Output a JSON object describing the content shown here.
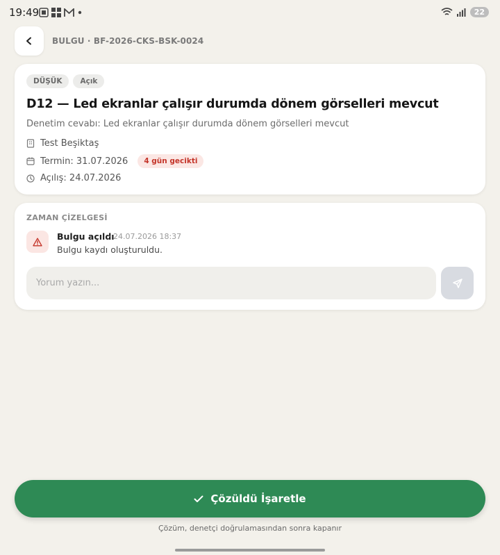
{
  "status_bar": {
    "time": "19:49",
    "battery": "22"
  },
  "header": {
    "breadcrumb": "BULGU · BF-2026-CKS-BSK-0024"
  },
  "finding": {
    "severity_badge": "DÜŞÜK",
    "status_badge": "Açık",
    "title": "D12 — Led ekranlar çalışır durumda dönem görselleri mevcut",
    "audit_answer": "Denetim cevabı: Led ekranlar çalışır durumda dönem görselleri mevcut",
    "location": "Test Beşiktaş",
    "due_date": "Termin: 31.07.2026",
    "late_badge": "4 gün gecikti",
    "opened_date": "Açılış: 24.07.2026"
  },
  "timeline": {
    "heading": "ZAMAN ÇİZELGESİ",
    "events": [
      {
        "title": "Bulgu açıldı",
        "time": "· 24.07.2026 18:37",
        "description": "Bulgu kaydı oluşturuldu."
      }
    ],
    "comment_placeholder": "Yorum yazın..."
  },
  "actions": {
    "resolve_label": "Çözüldü İşaretle",
    "footer_note": "Çözüm, denetçi doğrulamasından sonra kapanır"
  },
  "colors": {
    "background": "#f3f1eb",
    "primary_green": "#2e8a55",
    "late_red": "#c4352a"
  },
  "icons": [
    "chevron-left-icon",
    "building-icon",
    "calendar-icon",
    "clock-icon",
    "warning-icon",
    "send-icon",
    "check-icon"
  ]
}
